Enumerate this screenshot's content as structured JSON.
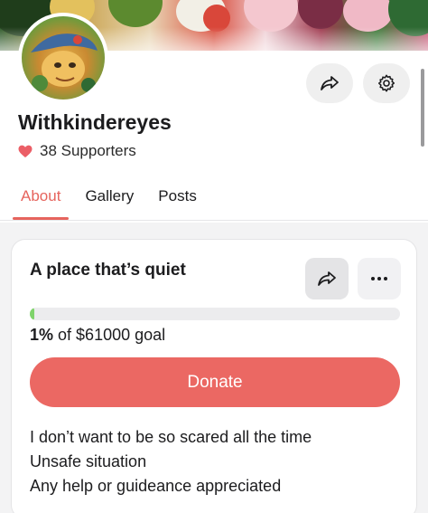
{
  "profile": {
    "name": "Withkindereyes",
    "supporters": "38 Supporters"
  },
  "tabs": [
    {
      "label": "About",
      "active": true
    },
    {
      "label": "Gallery",
      "active": false
    },
    {
      "label": "Posts",
      "active": false
    }
  ],
  "icons": {
    "share": "share-icon",
    "settings": "gear-icon",
    "heart": "heart-icon",
    "more": "more-horizontal-icon"
  },
  "fundraiser": {
    "title": "A place that’s quiet",
    "progress_percent": 1,
    "percent_label": "1%",
    "goal_text": "of $61000 goal",
    "donate_label": "Donate",
    "description": [
      "I don’t want to be so scared all the time",
      "Unsafe situation",
      "Any help or guideance appreciated"
    ]
  },
  "colors": {
    "accent": "#eb6863",
    "progress": "#7fd36b"
  }
}
